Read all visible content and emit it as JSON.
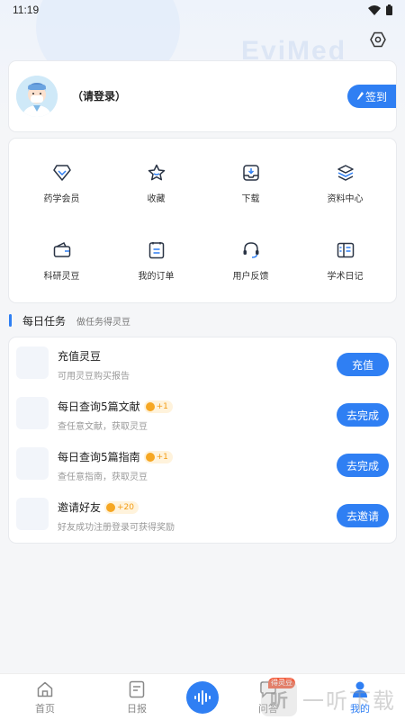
{
  "status_bar": {
    "time": "11:19"
  },
  "watermark_text": "EviMed",
  "profile": {
    "login_prompt": "（请登录）",
    "checkin_label": "签到"
  },
  "menu": {
    "items": [
      {
        "label": "药学会员",
        "icon": "vip-diamond-icon"
      },
      {
        "label": "收藏",
        "icon": "star-icon"
      },
      {
        "label": "下载",
        "icon": "download-icon"
      },
      {
        "label": "资料中心",
        "icon": "layers-icon"
      },
      {
        "label": "科研灵豆",
        "icon": "wallet-icon"
      },
      {
        "label": "我的订单",
        "icon": "order-icon"
      },
      {
        "label": "用户反馈",
        "icon": "headset-icon"
      },
      {
        "label": "学术日记",
        "icon": "diary-icon"
      }
    ]
  },
  "daily_tasks": {
    "title": "每日任务",
    "subtitle": "做任务得灵豆",
    "tasks": [
      {
        "name": "充值灵豆",
        "badge": "",
        "desc": "可用灵豆购买报告",
        "action": "充值"
      },
      {
        "name": "每日查询5篇文献",
        "badge": "+1",
        "desc": "查任意文献，获取灵豆",
        "action": "去完成"
      },
      {
        "name": "每日查询5篇指南",
        "badge": "+1",
        "desc": "查任意指南，获取灵豆",
        "action": "去完成"
      },
      {
        "name": "邀请好友",
        "badge": "+20",
        "desc": "好友成功注册登录可获得奖励",
        "action": "去邀请"
      }
    ]
  },
  "bottom_nav": {
    "items": [
      {
        "label": "首页",
        "icon": "home-icon"
      },
      {
        "label": "日报",
        "icon": "daily-report-icon"
      },
      {
        "label": "问答",
        "icon": "qa-icon",
        "tag": "得灵豆"
      },
      {
        "label": "我的",
        "icon": "profile-icon"
      }
    ],
    "active": "我的"
  },
  "bottom_watermark": {
    "logo_char": "听",
    "text": "一听下载"
  },
  "colors": {
    "accent": "#2f7ff3",
    "coin": "#f6a723",
    "tag": "#f05a3a"
  }
}
